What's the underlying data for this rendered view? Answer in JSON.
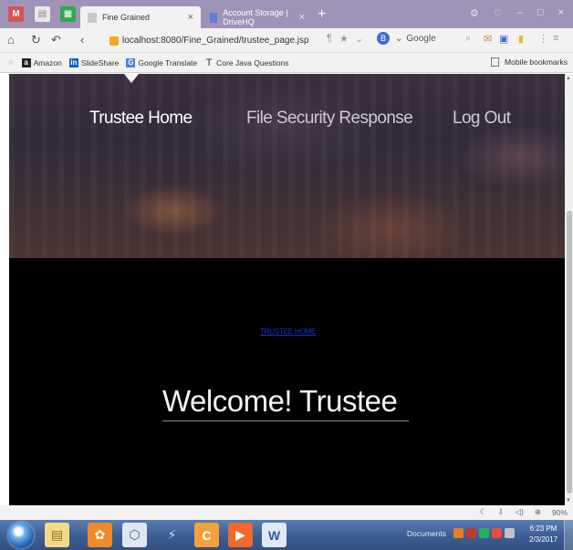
{
  "browser": {
    "tabs": [
      {
        "title": "Fine Grained",
        "active": true
      },
      {
        "title": "Account Storage | DriveHQ",
        "active": false
      }
    ],
    "url": "localhost:8080/Fine_Grained/trustee_page.jsp",
    "search_engine": "Google",
    "bookmarks": [
      "Amazon",
      "SlideShare",
      "Google Translate",
      "Core Java Questions"
    ],
    "mobile_bookmarks": "Mobile bookmarks",
    "zoom": "90%"
  },
  "page": {
    "nav": {
      "home": "Trustee Home",
      "response": "File Security Response",
      "logout": "Log Out"
    },
    "breadcrumb": "TRUSTEE HOME",
    "heading": "Welcome! Trustee"
  },
  "taskbar": {
    "documents_label": "Documents",
    "time": "6:23 PM",
    "date": "2/3/2017"
  },
  "colors": {
    "tabstrip": "#9f94b8",
    "taskbar": "#3d5f94",
    "link": "#1a32c8"
  }
}
